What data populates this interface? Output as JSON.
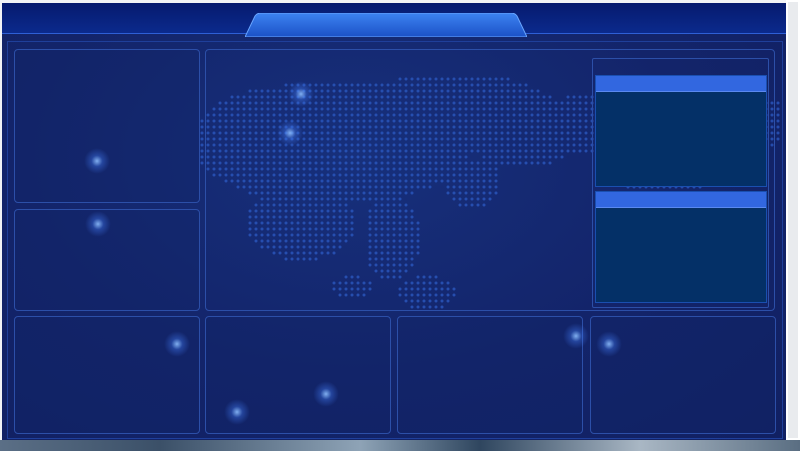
{
  "header": {
    "title": ""
  },
  "panels": {
    "top_left": {
      "title": ""
    },
    "middle_left": {
      "title": ""
    },
    "map": {
      "title": ""
    },
    "bottom_1": {
      "title": ""
    },
    "bottom_2": {
      "title": ""
    },
    "bottom_3": {
      "title": ""
    },
    "bottom_4": {
      "title": ""
    }
  },
  "info_cards": [
    {
      "title": ""
    },
    {
      "title": ""
    }
  ],
  "colors": {
    "background": "#13246a",
    "header": "#0b2a8c",
    "panel_border": "#2c4fa8",
    "card_header": "#3267e0",
    "card_body": "#043067",
    "map_dots": "#2c5bc4"
  },
  "icons": {
    "map": "world-map-dots-icon"
  }
}
